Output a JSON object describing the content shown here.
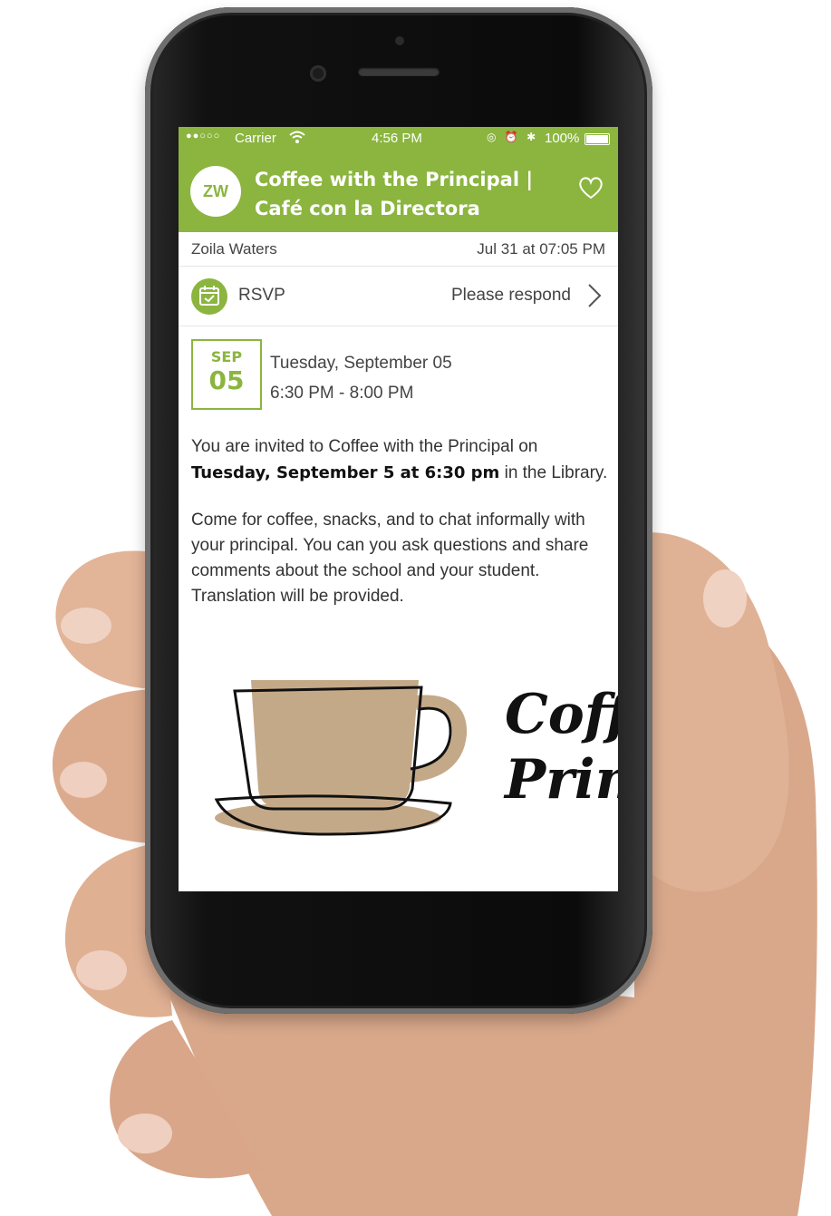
{
  "status_bar": {
    "signal": "●●○○○",
    "carrier": "Carrier",
    "time": "4:56 PM",
    "icons": "◎ ⏰ ✱",
    "battery": "100%"
  },
  "header": {
    "avatar_initials": "ZW",
    "title_line1": "Coffee with the Principal |",
    "title_line2": "Café con la Directora",
    "favorite_icon": "heart-icon"
  },
  "meta": {
    "author": "Zoila Waters",
    "posted": "Jul 31 at 07:05 PM"
  },
  "rsvp": {
    "icon": "calendar-check-icon",
    "label": "RSVP",
    "action": "Please respond"
  },
  "event": {
    "month": "SEP",
    "day": "05",
    "date_text": "Tuesday, September 05",
    "time_text": "6:30 PM - 8:00 PM"
  },
  "description": {
    "p1_start": "You are invited to Coffee with the Principal on",
    "p1_bold": "Tuesday, September 5 at 6:30 pm",
    "p1_end": " in the Library.",
    "p2": "Come for coffee, snacks, and to chat informally with your principal. You can you ask questions and share comments about the school and your student. Translation will be provided."
  },
  "artwork": {
    "line1": "Coff",
    "line2": "Prin"
  },
  "colors": {
    "accent": "#8bb53f",
    "cup": "#c4a989"
  }
}
